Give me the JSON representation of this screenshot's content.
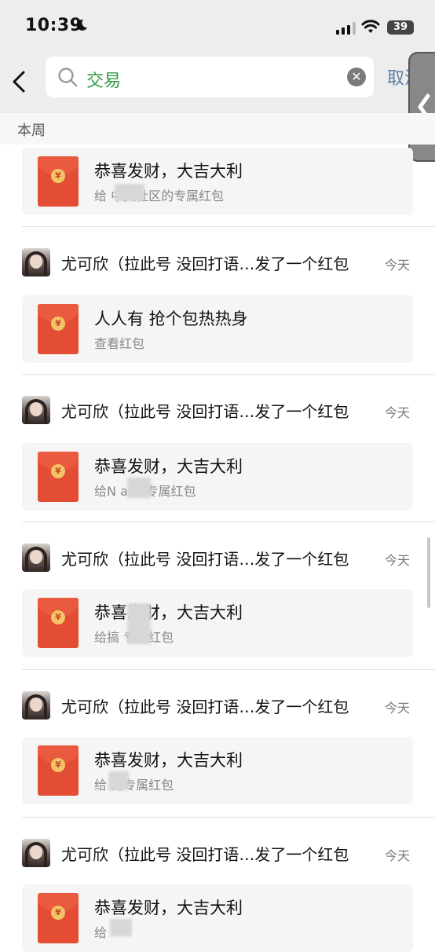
{
  "status_bar": {
    "time": "10:39",
    "battery": "39"
  },
  "search": {
    "query": "交易",
    "cancel_label": "取消"
  },
  "section_header": "本周",
  "first_card": {
    "title": "恭喜发财，大吉大利",
    "subtitle": "给        中文社区的专属红包"
  },
  "entries": [
    {
      "sender": "尤可欣（拉此号 没回打语…发了一个红包",
      "time": "今天",
      "card_title": "人人有 抢个包热热身",
      "card_subtitle": "查看红包"
    },
    {
      "sender": "尤可欣（拉此号 没回打语…发了一个红包",
      "time": "今天",
      "card_title": "恭喜发财，大吉大利",
      "card_subtitle": "给N        ar的专属红包"
    },
    {
      "sender": "尤可欣（拉此号 没回打语…发了一个红包",
      "time": "今天",
      "card_title": "恭喜发财，大吉大利",
      "card_subtitle": "给搞        专属红包"
    },
    {
      "sender": "尤可欣（拉此号 没回打语…发了一个红包",
      "time": "今天",
      "card_title": "恭喜发财，大吉大利",
      "card_subtitle": "给       的专属红包"
    },
    {
      "sender": "尤可欣（拉此号 没回打语…发了一个红包",
      "time": "今天",
      "card_title": "恭喜发财，大吉大利",
      "card_subtitle": "给"
    }
  ],
  "icons": {
    "back": "chevron-left-icon",
    "search": "search-icon",
    "clear": "clear-icon",
    "envelope": "red-envelope-icon",
    "edge_tab": "edge-tab-chevron-icon"
  },
  "colors": {
    "accent_green": "#2f9c45",
    "link_blue": "#5a7ea8",
    "envelope_red": "#e34d34"
  }
}
